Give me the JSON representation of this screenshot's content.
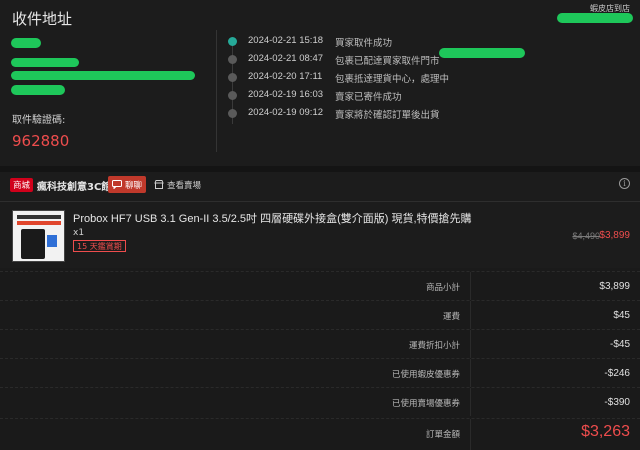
{
  "address": {
    "title": "收件地址",
    "store_link": "蝦皮店到店",
    "pickup_code_label": "取件驗證碼:",
    "pickup_code": "962880"
  },
  "timeline": [
    {
      "time": "2024-02-21 15:18",
      "text": "買家取件成功",
      "active": true
    },
    {
      "time": "2024-02-21 08:47",
      "text": "包裹已配達買家取件門市",
      "active": false
    },
    {
      "time": "2024-02-20 17:11",
      "text": "包裹抵達理貨中心，處理中",
      "active": false
    },
    {
      "time": "2024-02-19 16:03",
      "text": "賣家已寄件成功",
      "active": false
    },
    {
      "time": "2024-02-19 09:12",
      "text": "賣家將於確認訂單後出貨",
      "active": false
    }
  ],
  "shop": {
    "badge": "商城",
    "name": "瘋科技創意3C館",
    "chat_label": "聊聊",
    "visit_label": "查看賣場"
  },
  "product": {
    "name": "Probox HF7 USB 3.1 Gen-II 3.5/2.5吋 四層硬碟外接盒(雙介面版) 現貨,特價搶先購",
    "qty": "x1",
    "return_tag": "15 天鑑賞期",
    "price_original": "$4,490",
    "price_current": "$3,899"
  },
  "summary": [
    {
      "label": "商品小計",
      "value": "$3,899"
    },
    {
      "label": "運費",
      "value": "$45"
    },
    {
      "label": "運費折扣小計",
      "value": "-$45"
    },
    {
      "label": "已使用蝦皮優惠券",
      "value": "-$246"
    },
    {
      "label": "已使用賣場優惠券",
      "value": "-$390"
    },
    {
      "label": "訂單金額",
      "value": "$3,263",
      "total": true
    }
  ],
  "colors": {
    "accent": "#ee4d4d",
    "timeline_active": "#26aa99",
    "mall_badge": "#d0011b"
  }
}
